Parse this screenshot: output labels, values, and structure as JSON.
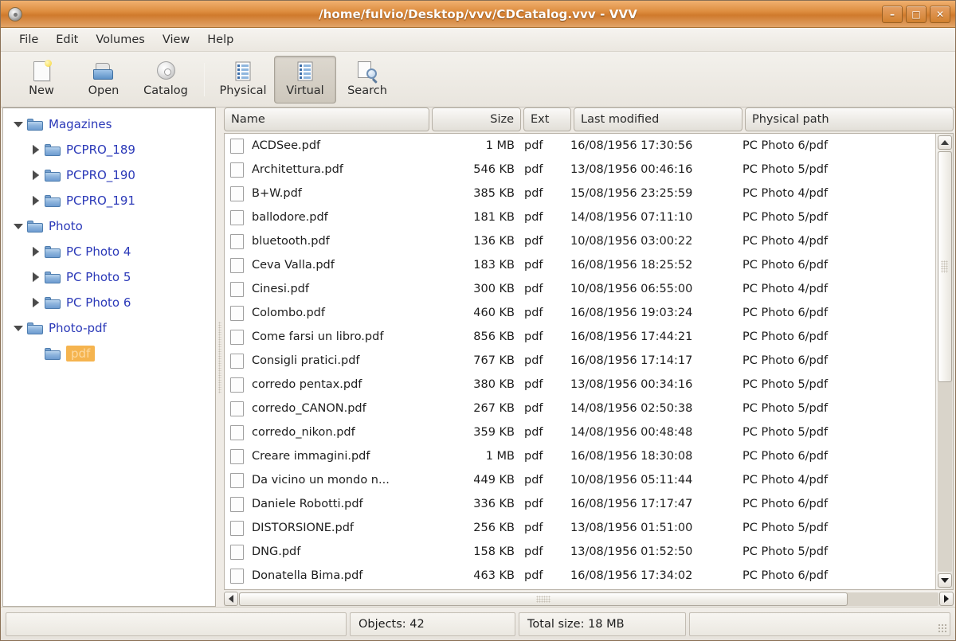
{
  "window": {
    "title": "/home/fulvio/Desktop/vvv/CDCatalog.vvv - VVV",
    "app_icon": "disc-icon",
    "minimize_label": "–",
    "maximize_label": "□",
    "close_label": "✕",
    "accent_color": "#d2812f",
    "titlebar_text_color": "#ffffff"
  },
  "menubar": {
    "items": [
      {
        "label": "File"
      },
      {
        "label": "Edit"
      },
      {
        "label": "Volumes"
      },
      {
        "label": "View"
      },
      {
        "label": "Help"
      }
    ]
  },
  "toolbar": {
    "buttons": [
      {
        "label": "New",
        "icon": "new-document-icon",
        "active": false
      },
      {
        "label": "Open",
        "icon": "open-folder-icon",
        "active": false
      },
      {
        "label": "Catalog",
        "icon": "cd-disc-icon",
        "active": false
      },
      {
        "label": "Physical",
        "icon": "list-view-icon",
        "active": false
      },
      {
        "label": "Virtual",
        "icon": "list-view-icon",
        "active": true
      },
      {
        "label": "Search",
        "icon": "search-icon",
        "active": false
      }
    ]
  },
  "tree": {
    "items": [
      {
        "label": "Magazines",
        "level": 0,
        "expander": "down",
        "selected": false
      },
      {
        "label": "PCPRO_189",
        "level": 1,
        "expander": "right",
        "selected": false
      },
      {
        "label": "PCPRO_190",
        "level": 1,
        "expander": "right",
        "selected": false
      },
      {
        "label": "PCPRO_191",
        "level": 1,
        "expander": "right",
        "selected": false
      },
      {
        "label": "Photo",
        "level": 0,
        "expander": "down",
        "selected": false
      },
      {
        "label": "PC Photo 4",
        "level": 1,
        "expander": "right",
        "selected": false
      },
      {
        "label": "PC Photo 5",
        "level": 1,
        "expander": "right",
        "selected": false
      },
      {
        "label": "PC Photo 6",
        "level": 1,
        "expander": "right",
        "selected": false
      },
      {
        "label": "Photo-pdf",
        "level": 0,
        "expander": "down",
        "selected": false
      },
      {
        "label": "pdf",
        "level": 1,
        "expander": "none",
        "selected": true
      }
    ],
    "selection_color": "#f5b44f",
    "label_color": "#2b39b8"
  },
  "file_list": {
    "columns": [
      {
        "key": "name",
        "label": "Name",
        "align": "left"
      },
      {
        "key": "size",
        "label": "Size",
        "align": "right"
      },
      {
        "key": "ext",
        "label": "Ext",
        "align": "left"
      },
      {
        "key": "mod",
        "label": "Last modified",
        "align": "left"
      },
      {
        "key": "path",
        "label": "Physical path",
        "align": "left"
      }
    ],
    "rows": [
      {
        "name": "ACDSee.pdf",
        "size": "1 MB",
        "ext": "pdf",
        "mod": "16/08/1956 17:30:56",
        "path": "PC Photo 6/pdf"
      },
      {
        "name": "Architettura.pdf",
        "size": "546 KB",
        "ext": "pdf",
        "mod": "13/08/1956 00:46:16",
        "path": "PC Photo 5/pdf"
      },
      {
        "name": "B+W.pdf",
        "size": "385 KB",
        "ext": "pdf",
        "mod": "15/08/1956 23:25:59",
        "path": "PC Photo 4/pdf"
      },
      {
        "name": "ballodore.pdf",
        "size": "181 KB",
        "ext": "pdf",
        "mod": "14/08/1956 07:11:10",
        "path": "PC Photo 5/pdf"
      },
      {
        "name": "bluetooth.pdf",
        "size": "136 KB",
        "ext": "pdf",
        "mod": "10/08/1956 03:00:22",
        "path": "PC Photo 4/pdf"
      },
      {
        "name": "Ceva Valla.pdf",
        "size": "183 KB",
        "ext": "pdf",
        "mod": "16/08/1956 18:25:52",
        "path": "PC Photo 6/pdf"
      },
      {
        "name": "Cinesi.pdf",
        "size": "300 KB",
        "ext": "pdf",
        "mod": "10/08/1956 06:55:00",
        "path": "PC Photo 4/pdf"
      },
      {
        "name": "Colombo.pdf",
        "size": "460 KB",
        "ext": "pdf",
        "mod": "16/08/1956 19:03:24",
        "path": "PC Photo 6/pdf"
      },
      {
        "name": "Come farsi un libro.pdf",
        "size": "856 KB",
        "ext": "pdf",
        "mod": "16/08/1956 17:44:21",
        "path": "PC Photo 6/pdf"
      },
      {
        "name": "Consigli pratici.pdf",
        "size": "767 KB",
        "ext": "pdf",
        "mod": "16/08/1956 17:14:17",
        "path": "PC Photo 6/pdf"
      },
      {
        "name": "corredo pentax.pdf",
        "size": "380 KB",
        "ext": "pdf",
        "mod": "13/08/1956 00:34:16",
        "path": "PC Photo 5/pdf"
      },
      {
        "name": "corredo_CANON.pdf",
        "size": "267 KB",
        "ext": "pdf",
        "mod": "14/08/1956 02:50:38",
        "path": "PC Photo 5/pdf"
      },
      {
        "name": "corredo_nikon.pdf",
        "size": "359 KB",
        "ext": "pdf",
        "mod": "14/08/1956 00:48:48",
        "path": "PC Photo 5/pdf"
      },
      {
        "name": "Creare immagini.pdf",
        "size": "1 MB",
        "ext": "pdf",
        "mod": "16/08/1956 18:30:08",
        "path": "PC Photo 6/pdf"
      },
      {
        "name": "Da vicino un mondo n...",
        "size": "449 KB",
        "ext": "pdf",
        "mod": "10/08/1956 05:11:44",
        "path": "PC Photo 4/pdf"
      },
      {
        "name": "Daniele Robotti.pdf",
        "size": "336 KB",
        "ext": "pdf",
        "mod": "16/08/1956 17:17:47",
        "path": "PC Photo 6/pdf"
      },
      {
        "name": "DISTORSIONE.pdf",
        "size": "256 KB",
        "ext": "pdf",
        "mod": "13/08/1956 01:51:00",
        "path": "PC Photo 5/pdf"
      },
      {
        "name": "DNG.pdf",
        "size": "158 KB",
        "ext": "pdf",
        "mod": "13/08/1956 01:52:50",
        "path": "PC Photo 5/pdf"
      },
      {
        "name": "Donatella Bima.pdf",
        "size": "463 KB",
        "ext": "pdf",
        "mod": "16/08/1956 17:34:02",
        "path": "PC Photo 6/pdf"
      }
    ]
  },
  "statusbar": {
    "cell1": "",
    "objects": "Objects: 42",
    "total_size": "Total size: 18 MB",
    "cell4": ""
  }
}
